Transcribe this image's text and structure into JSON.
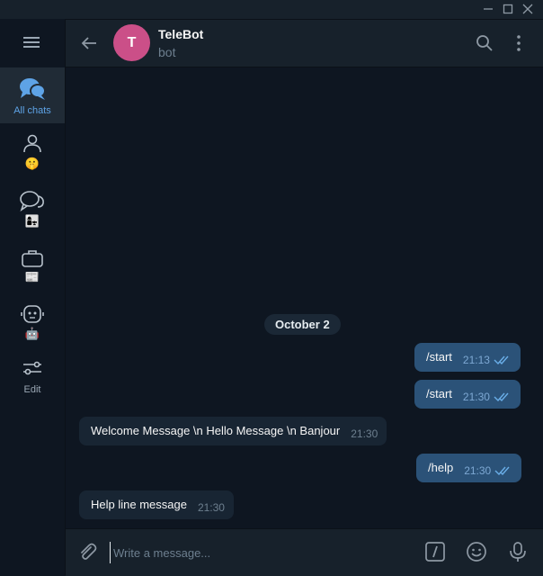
{
  "window": {
    "controls": [
      "minimize-icon",
      "maximize-icon",
      "close-icon"
    ]
  },
  "sidebar": {
    "menu_icon": "hamburger-icon",
    "folders": [
      {
        "label": "All chats",
        "icon": "chats-icon",
        "active": true
      },
      {
        "label": "",
        "icon": "person-icon",
        "emoji": "🤫"
      },
      {
        "label": "",
        "icon": "chat-bubbles-icon",
        "emoji": "👩‍👧"
      },
      {
        "label": "",
        "icon": "briefcase-icon",
        "emoji": "📰"
      },
      {
        "label": "",
        "icon": "robot-icon",
        "emoji": "🤖"
      },
      {
        "label": "Edit",
        "icon": "sliders-icon"
      }
    ]
  },
  "header": {
    "avatar_letter": "T",
    "title": "TeleBot",
    "subtitle": "bot",
    "avatar_color": "#cb4f88"
  },
  "chat": {
    "date_separator": "October 2",
    "messages": [
      {
        "direction": "out",
        "text": "/start",
        "time": "21:13",
        "read": true
      },
      {
        "direction": "out",
        "text": "/start",
        "time": "21:30",
        "read": true
      },
      {
        "direction": "in",
        "text": "Welcome Message \\n Hello Message \\n Banjour",
        "time": "21:30"
      },
      {
        "direction": "out",
        "text": "/help",
        "time": "21:30",
        "read": true
      },
      {
        "direction": "in",
        "text": "Help line message",
        "time": "21:30"
      }
    ]
  },
  "composer": {
    "placeholder": "Write a message...",
    "value": ""
  },
  "colors": {
    "background": "#0e1621",
    "panel": "#17212b",
    "outgoing_bubble": "#2b5278",
    "incoming_bubble": "#182533",
    "accent": "#5ea3e6"
  }
}
